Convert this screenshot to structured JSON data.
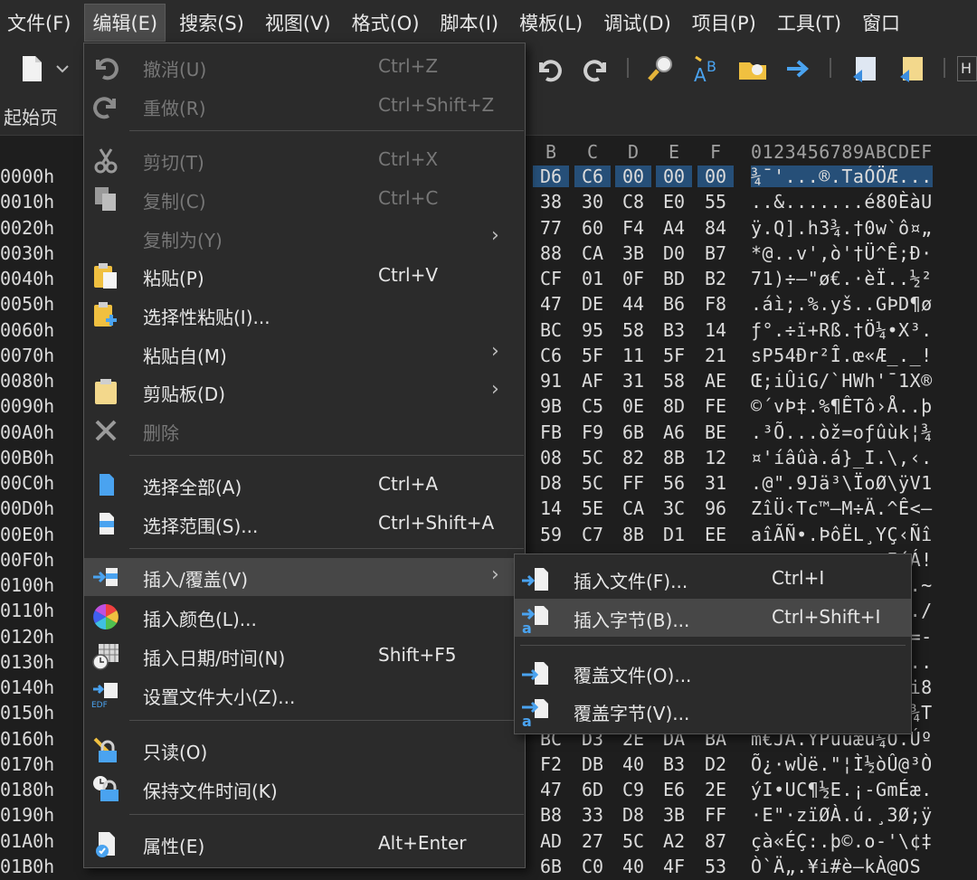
{
  "menubar": {
    "items": [
      {
        "label": "文件(F)"
      },
      {
        "label": "编辑(E)"
      },
      {
        "label": "搜索(S)"
      },
      {
        "label": "视图(V)"
      },
      {
        "label": "格式(O)"
      },
      {
        "label": "脚本(I)"
      },
      {
        "label": "模板(L)"
      },
      {
        "label": "调试(D)"
      },
      {
        "label": "项目(P)"
      },
      {
        "label": "工具(T)"
      },
      {
        "label": "窗口"
      }
    ]
  },
  "tabs": {
    "start_page": "起始页"
  },
  "hex_view": {
    "header_cols": [
      "B",
      "C",
      "D",
      "E",
      "F"
    ],
    "ascii_header": "0123456789ABCDEF",
    "rows": [
      {
        "addr": "0000h",
        "bytes": [
          "D6",
          "C6",
          "00",
          "00",
          "00"
        ],
        "ascii": "¾¯'...®.TaÓÖÆ..."
      },
      {
        "addr": "0010h",
        "bytes": [
          "38",
          "30",
          "C8",
          "E0",
          "55"
        ],
        "ascii": "..&.......é80ÈàU"
      },
      {
        "addr": "0020h",
        "bytes": [
          "77",
          "60",
          "F4",
          "A4",
          "84"
        ],
        "ascii": "ÿ.Q].h3¾.†0w`ô¤„"
      },
      {
        "addr": "0030h",
        "bytes": [
          "88",
          "CA",
          "3B",
          "D0",
          "B7"
        ],
        "ascii": "*@..v',ò'†Ü^Ê;Ð·"
      },
      {
        "addr": "0040h",
        "bytes": [
          "CF",
          "01",
          "0F",
          "BD",
          "B2"
        ],
        "ascii": "71)÷–\"ø€.·èÏ..½²"
      },
      {
        "addr": "0050h",
        "bytes": [
          "47",
          "DE",
          "44",
          "B6",
          "F8"
        ],
        "ascii": ".áì;.%.yš..GÞD¶ø"
      },
      {
        "addr": "0060h",
        "bytes": [
          "BC",
          "95",
          "58",
          "B3",
          "14"
        ],
        "ascii": "ƒ°.÷ï+Rß.†Ö¼•X³."
      },
      {
        "addr": "0070h",
        "bytes": [
          "C6",
          "5F",
          "11",
          "5F",
          "21"
        ],
        "ascii": "sP54Ðr²Î.œ«Æ_._!"
      },
      {
        "addr": "0080h",
        "bytes": [
          "91",
          "AF",
          "31",
          "58",
          "AE"
        ],
        "ascii": "Œ;iÛiG/`HWh'¯1X®"
      },
      {
        "addr": "0090h",
        "bytes": [
          "9B",
          "C5",
          "0E",
          "8D",
          "FE"
        ],
        "ascii": "©´vÞ‡.%¶ÊTô›Å..þ"
      },
      {
        "addr": "00A0h",
        "bytes": [
          "FB",
          "F9",
          "6B",
          "A6",
          "BE"
        ],
        "ascii": ".³Õ...òž=oƒûùk¦¾"
      },
      {
        "addr": "00B0h",
        "bytes": [
          "08",
          "5C",
          "82",
          "8B",
          "12"
        ],
        "ascii": "¤'íâûà.á}_I.\\,‹."
      },
      {
        "addr": "00C0h",
        "bytes": [
          "D8",
          "5C",
          "FF",
          "56",
          "31"
        ],
        "ascii": ".@\".9Jä³\\ÏoØ\\ÿV1"
      },
      {
        "addr": "00D0h",
        "bytes": [
          "14",
          "5E",
          "CA",
          "3C",
          "96"
        ],
        "ascii": "ZîÜ‹Tc™–M÷Ä.^Ê<–"
      },
      {
        "addr": "00E0h",
        "bytes": [
          "59",
          "C7",
          "8B",
          "D1",
          "EE"
        ],
        "ascii": "aîÃÑ•.ÞôËL¸YÇ‹Ñî"
      },
      {
        "addr": "00F0h",
        "bytes": [
          "",
          "",
          "",
          "",
          ""
        ],
        "ascii": "            IúÁ!"
      },
      {
        "addr": "0100h",
        "bytes": [
          "",
          "",
          "",
          "",
          ""
        ],
        "ascii": "            ûú.~"
      },
      {
        "addr": "0110h",
        "bytes": [
          "",
          "",
          "",
          "",
          ""
        ],
        "ascii": "            f&./"
      },
      {
        "addr": "0120h",
        "bytes": [
          "",
          "",
          "",
          "",
          ""
        ],
        "ascii": "            $û=-"
      },
      {
        "addr": "0130h",
        "bytes": [
          "",
          "",
          "",
          "",
          ""
        ],
        "ascii": "            «ì.."
      },
      {
        "addr": "0140h",
        "bytes": [
          "",
          "",
          "",
          "",
          ""
        ],
        "ascii": "            .øi8"
      },
      {
        "addr": "0150h",
        "bytes": [
          "",
          "",
          "",
          "",
          ""
        ],
        "ascii": "            þÄ¾T"
      },
      {
        "addr": "0160h",
        "bytes": [
          "BC",
          "D3",
          "2E",
          "DA",
          "BA"
        ],
        "ascii": "m€JA.YPuuæu¼Ó.Úº"
      },
      {
        "addr": "0170h",
        "bytes": [
          "F2",
          "DB",
          "40",
          "B3",
          "D2"
        ],
        "ascii": "Õ¿·wÙë.\"¦Ì½òÛ@³Ò"
      },
      {
        "addr": "0180h",
        "bytes": [
          "47",
          "6D",
          "C9",
          "E6",
          "2E"
        ],
        "ascii": "ýI•UC¶½E.¡-GmÉæ."
      },
      {
        "addr": "0190h",
        "bytes": [
          "B8",
          "33",
          "D8",
          "3B",
          "FF"
        ],
        "ascii": "·E\"·zïØÀ.ú.¸3Ø;ÿ"
      },
      {
        "addr": "01A0h",
        "bytes": [
          "AD",
          "27",
          "5C",
          "A2",
          "87"
        ],
        "ascii": "çà«ÉÇ:.þ©.o-'\\¢‡"
      },
      {
        "addr": "01B0h",
        "bytes": [
          "6B",
          "C0",
          "40",
          "4F",
          "53"
        ],
        "ascii": "Ò`Ä„.¥i#è–kÀ@OS"
      }
    ]
  },
  "edit_menu": {
    "items": [
      {
        "label": "撤消(U)",
        "shortcut": "Ctrl+Z",
        "icon": "undo-icon"
      },
      {
        "label": "重做(R)",
        "shortcut": "Ctrl+Shift+Z",
        "icon": "redo-icon"
      },
      {
        "label": "剪切(T)",
        "shortcut": "Ctrl+X",
        "icon": "scissors-icon"
      },
      {
        "label": "复制(C)",
        "shortcut": "Ctrl+C",
        "icon": "copy-icon"
      },
      {
        "label": "复制为(Y)",
        "shortcut": "",
        "icon": ""
      },
      {
        "label": "粘贴(P)",
        "shortcut": "Ctrl+V",
        "icon": "paste-icon"
      },
      {
        "label": "选择性粘贴(I)...",
        "shortcut": "",
        "icon": "paste-special-icon"
      },
      {
        "label": "粘贴自(M)",
        "shortcut": "",
        "icon": ""
      },
      {
        "label": "剪贴板(D)",
        "shortcut": "",
        "icon": "clipboard-icon"
      },
      {
        "label": "删除",
        "shortcut": "",
        "icon": "delete-icon"
      },
      {
        "label": "选择全部(A)",
        "shortcut": "Ctrl+A",
        "icon": "select-all-icon"
      },
      {
        "label": "选择范围(S)...",
        "shortcut": "Ctrl+Shift+A",
        "icon": "select-range-icon"
      },
      {
        "label": "插入/覆盖(V)",
        "shortcut": "",
        "icon": "insert-overwrite-icon"
      },
      {
        "label": "插入颜色(L)...",
        "shortcut": "",
        "icon": "color-wheel-icon"
      },
      {
        "label": "插入日期/时间(N)",
        "shortcut": "Shift+F5",
        "icon": "calendar-clock-icon"
      },
      {
        "label": "设置文件大小(Z)...",
        "shortcut": "",
        "icon": "file-size-icon"
      },
      {
        "label": "只读(O)",
        "shortcut": "",
        "icon": "readonly-lock-icon"
      },
      {
        "label": "保持文件时间(K)",
        "shortcut": "",
        "icon": "keep-time-lock-icon"
      },
      {
        "label": "属性(E)",
        "shortcut": "Alt+Enter",
        "icon": "properties-icon"
      }
    ]
  },
  "insert_submenu": {
    "items": [
      {
        "label": "插入文件(F)...",
        "shortcut": "Ctrl+I"
      },
      {
        "label": "插入字节(B)...",
        "shortcut": "Ctrl+Shift+I"
      },
      {
        "label": "覆盖文件(O)...",
        "shortcut": ""
      },
      {
        "label": "覆盖字节(V)...",
        "shortcut": ""
      }
    ]
  },
  "icons": {
    "toolbar": [
      "new-file-icon",
      "undo-icon",
      "redo-icon",
      "find-icon",
      "replace-icon",
      "find-in-files-icon",
      "goto-icon",
      "bookmark-icon",
      "script-icon"
    ],
    "edf_text": "EDF"
  },
  "colors": {
    "background": "#1e1e1e",
    "menu_bg": "#2b2b2b",
    "highlight": "#474747",
    "selection": "#264f78",
    "accent_blue": "#4aa3f0",
    "accent_yellow": "#f0c040"
  }
}
